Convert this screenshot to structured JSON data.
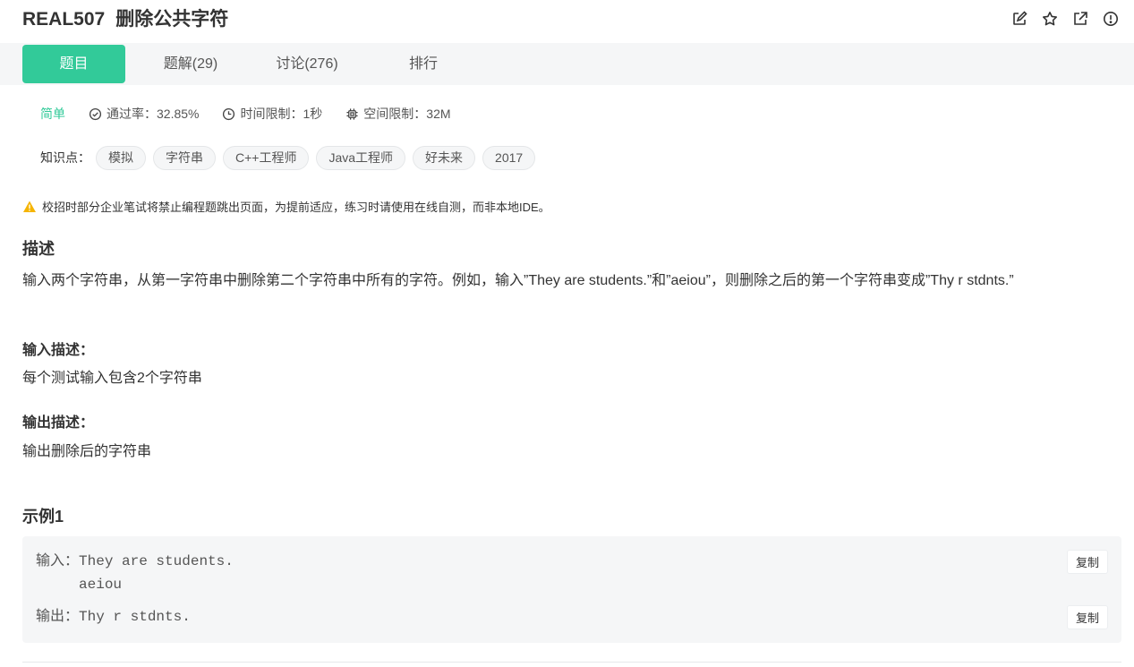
{
  "header": {
    "problem_id": "REAL507",
    "problem_title": "删除公共字符",
    "icons": [
      "edit-icon",
      "star-icon",
      "external-link-icon",
      "report-icon"
    ]
  },
  "tabs": [
    {
      "label": "题目",
      "active": true
    },
    {
      "label": "题解(29)",
      "active": false
    },
    {
      "label": "讨论(276)",
      "active": false
    },
    {
      "label": "排行",
      "active": false
    }
  ],
  "meta": {
    "difficulty": "简单",
    "pass_rate": "通过率：32.85%",
    "time_limit": "时间限制：1秒",
    "space_limit": "空间限制：32M"
  },
  "knowledge": {
    "label": "知识点：",
    "tags": [
      "模拟",
      "字符串",
      "C++工程师",
      "Java工程师",
      "好未来",
      "2017"
    ]
  },
  "warning": "校招时部分企业笔试将禁止编程题跳出页面，为提前适应，练习时请使用在线自测，而非本地IDE。",
  "description": {
    "heading": "描述",
    "text": "输入两个字符串，从第一字符串中删除第二个字符串中所有的字符。例如，输入”They are students.”和”aeiou”，则删除之后的第一个字符串变成”Thy r stdnts.”"
  },
  "input_desc": {
    "heading": "输入描述：",
    "text": "每个测试输入包含2个字符串"
  },
  "output_desc": {
    "heading": "输出描述：",
    "text": "输出删除后的字符串"
  },
  "example": {
    "heading": "示例1",
    "input_label": "输入：",
    "input_lines": "They are students.\naeiou",
    "output_label": "输出：",
    "output_lines": "Thy r stdnts.",
    "copy_label": "复制"
  },
  "colors": {
    "accent": "#32ca99",
    "warning": "#f5b400"
  }
}
